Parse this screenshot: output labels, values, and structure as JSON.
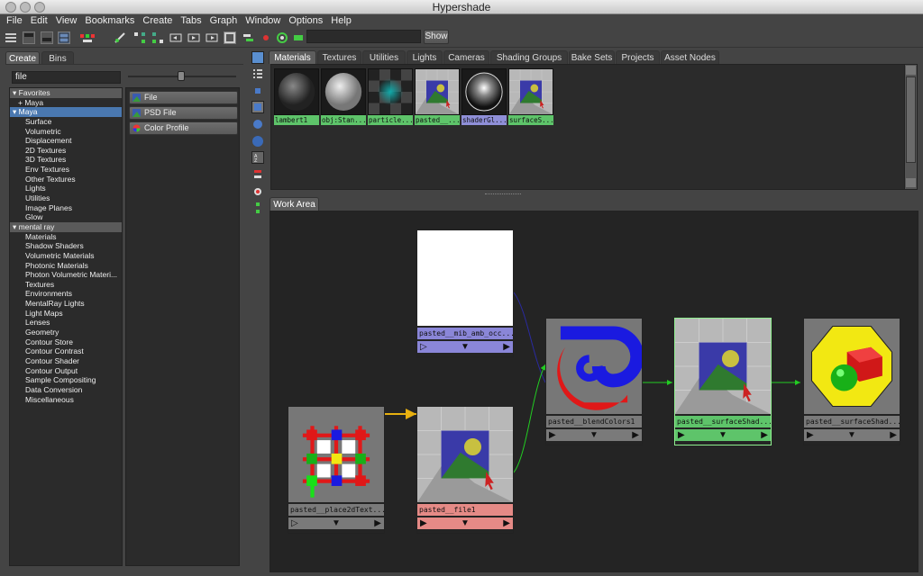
{
  "window": {
    "title": "Hypershade"
  },
  "menu": [
    "File",
    "Edit",
    "View",
    "Bookmarks",
    "Create",
    "Tabs",
    "Graph",
    "Window",
    "Options",
    "Help"
  ],
  "toolbar": {
    "show_label": "Show",
    "search_value": ""
  },
  "left": {
    "tabs": [
      "Create",
      "Bins"
    ],
    "filter_value": "file",
    "tree": [
      {
        "label": "Favorites",
        "kind": "cat",
        "prefix": "▾"
      },
      {
        "label": "Maya",
        "kind": "item",
        "prefix": "+"
      },
      {
        "label": "Maya",
        "kind": "sel",
        "prefix": "▾"
      },
      {
        "label": "Surface",
        "kind": "item"
      },
      {
        "label": "Volumetric",
        "kind": "item"
      },
      {
        "label": "Displacement",
        "kind": "item"
      },
      {
        "label": "2D Textures",
        "kind": "item"
      },
      {
        "label": "3D Textures",
        "kind": "item"
      },
      {
        "label": "Env Textures",
        "kind": "item"
      },
      {
        "label": "Other Textures",
        "kind": "item"
      },
      {
        "label": "Lights",
        "kind": "item"
      },
      {
        "label": "Utilities",
        "kind": "item"
      },
      {
        "label": "Image Planes",
        "kind": "item"
      },
      {
        "label": "Glow",
        "kind": "item"
      },
      {
        "label": "mental ray",
        "kind": "cat",
        "prefix": "▾"
      },
      {
        "label": "Materials",
        "kind": "item"
      },
      {
        "label": "Shadow Shaders",
        "kind": "item"
      },
      {
        "label": "Volumetric Materials",
        "kind": "item"
      },
      {
        "label": "Photonic Materials",
        "kind": "item"
      },
      {
        "label": "Photon Volumetric Materi...",
        "kind": "item"
      },
      {
        "label": "Textures",
        "kind": "item"
      },
      {
        "label": "Environments",
        "kind": "item"
      },
      {
        "label": "MentalRay Lights",
        "kind": "item"
      },
      {
        "label": "Light Maps",
        "kind": "item"
      },
      {
        "label": "Lenses",
        "kind": "item"
      },
      {
        "label": "Geometry",
        "kind": "item"
      },
      {
        "label": "Contour Store",
        "kind": "item"
      },
      {
        "label": "Contour Contrast",
        "kind": "item"
      },
      {
        "label": "Contour Shader",
        "kind": "item"
      },
      {
        "label": "Contour Output",
        "kind": "item"
      },
      {
        "label": "Sample Compositing",
        "kind": "item"
      },
      {
        "label": "Data Conversion",
        "kind": "item"
      },
      {
        "label": "Miscellaneous",
        "kind": "item"
      }
    ],
    "nodes": [
      "File",
      "PSD File",
      "Color Profile"
    ]
  },
  "materials": {
    "tabs": [
      "Materials",
      "Textures",
      "Utilities",
      "Lights",
      "Cameras",
      "Shading Groups",
      "Bake Sets",
      "Projects",
      "Asset Nodes"
    ],
    "swatches": [
      {
        "label": "lambert1",
        "color": "#5ec46a",
        "icon": "grey-sphere"
      },
      {
        "label": "obj:Stan...",
        "color": "#5ec46a",
        "icon": "white-sphere"
      },
      {
        "label": "particle...",
        "color": "#5ec46a",
        "icon": "particle-cloud"
      },
      {
        "label": "pasted__...",
        "color": "#5ec46a",
        "icon": "texture-image"
      },
      {
        "label": "shaderGl...",
        "color": "#8f8fd8",
        "icon": "glow-sphere"
      },
      {
        "label": "surfaceS...",
        "color": "#5ec46a",
        "icon": "texture-image"
      }
    ]
  },
  "workarea": {
    "tab": "Work Area",
    "nodes": [
      {
        "id": "amb",
        "label": "pasted__mib_amb_occ...",
        "color": "#8a86d8",
        "icon": "blank-white"
      },
      {
        "id": "blend",
        "label": "pasted__blendColors1",
        "color": "#7a7a7a",
        "icon": "blend-spiral"
      },
      {
        "id": "surf1",
        "label": "pasted__surfaceShad...",
        "color": "#5ec46a",
        "icon": "texture-image"
      },
      {
        "id": "surf2",
        "label": "pasted__surfaceShad...",
        "color": "#7a7a7a",
        "icon": "surface-shader"
      },
      {
        "id": "place",
        "label": "pasted__place2dText...",
        "color": "#7a7a7a",
        "icon": "place2d-grid"
      },
      {
        "id": "file",
        "label": "pasted__file1",
        "color": "#e58a86",
        "icon": "texture-image"
      }
    ]
  }
}
